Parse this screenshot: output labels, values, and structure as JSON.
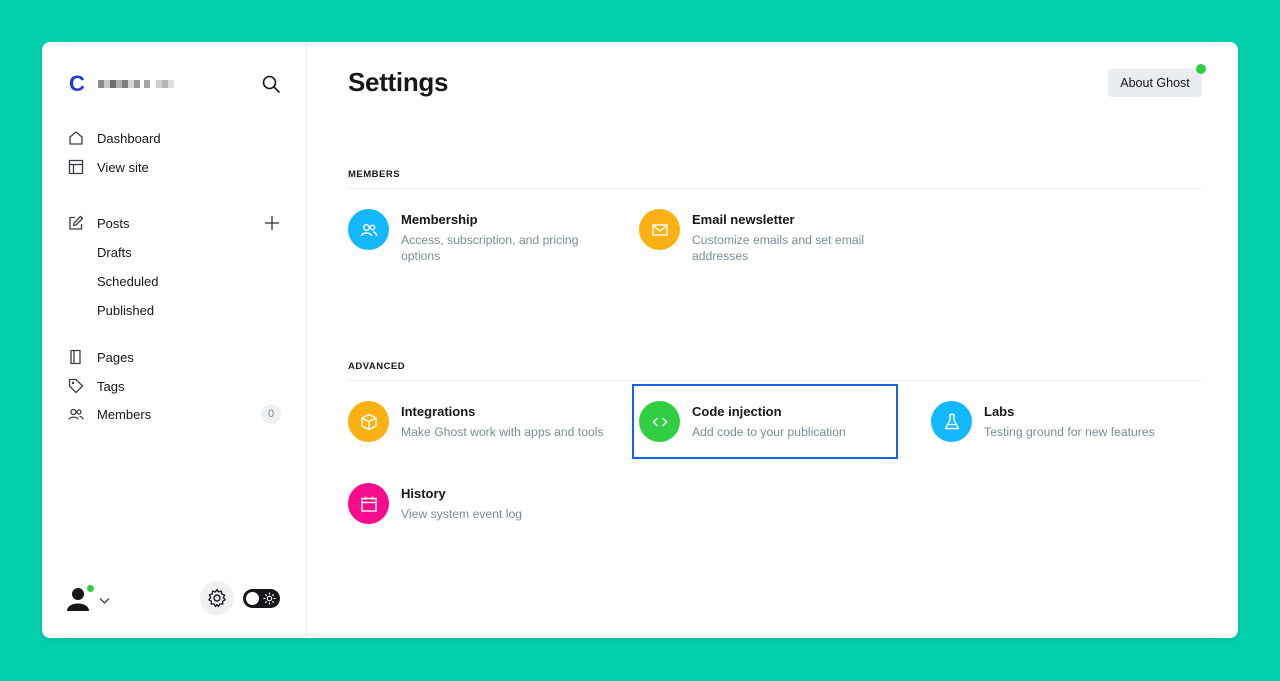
{
  "sidebar": {
    "brand_initial": "C",
    "nav": [
      {
        "label": "Dashboard"
      },
      {
        "label": "View site"
      },
      {
        "label": "Posts"
      },
      {
        "label": "Drafts"
      },
      {
        "label": "Scheduled"
      },
      {
        "label": "Published"
      },
      {
        "label": "Pages"
      },
      {
        "label": "Tags"
      },
      {
        "label": "Members"
      }
    ],
    "members_count": "0"
  },
  "main": {
    "title": "Settings",
    "about_button": "About Ghost",
    "sections": [
      {
        "heading": "MEMBERS",
        "tiles": [
          {
            "title": "Membership",
            "desc": "Access, subscription, and pricing options",
            "icon": "members-icon",
            "color": "#14b8ff"
          },
          {
            "title": "Email newsletter",
            "desc": "Customize emails and set email addresses",
            "icon": "envelope-icon",
            "color": "#fbb114"
          }
        ]
      },
      {
        "heading": "ADVANCED",
        "tiles": [
          {
            "title": "Integrations",
            "desc": "Make Ghost work with apps and tools",
            "icon": "box-icon",
            "color": "#fbb114"
          },
          {
            "title": "Code injection",
            "desc": "Add code to your publication",
            "icon": "code-icon",
            "color": "#30cf43"
          },
          {
            "title": "Labs",
            "desc": "Testing ground for new features",
            "icon": "flask-icon",
            "color": "#14b8ff"
          },
          {
            "title": "History",
            "desc": "View system event log",
            "icon": "calendar-icon",
            "color": "#f90c8b"
          }
        ]
      }
    ]
  },
  "colors": {
    "background": "#03cfac",
    "accent": "#1f3be6",
    "highlight": "#1a63e8"
  }
}
